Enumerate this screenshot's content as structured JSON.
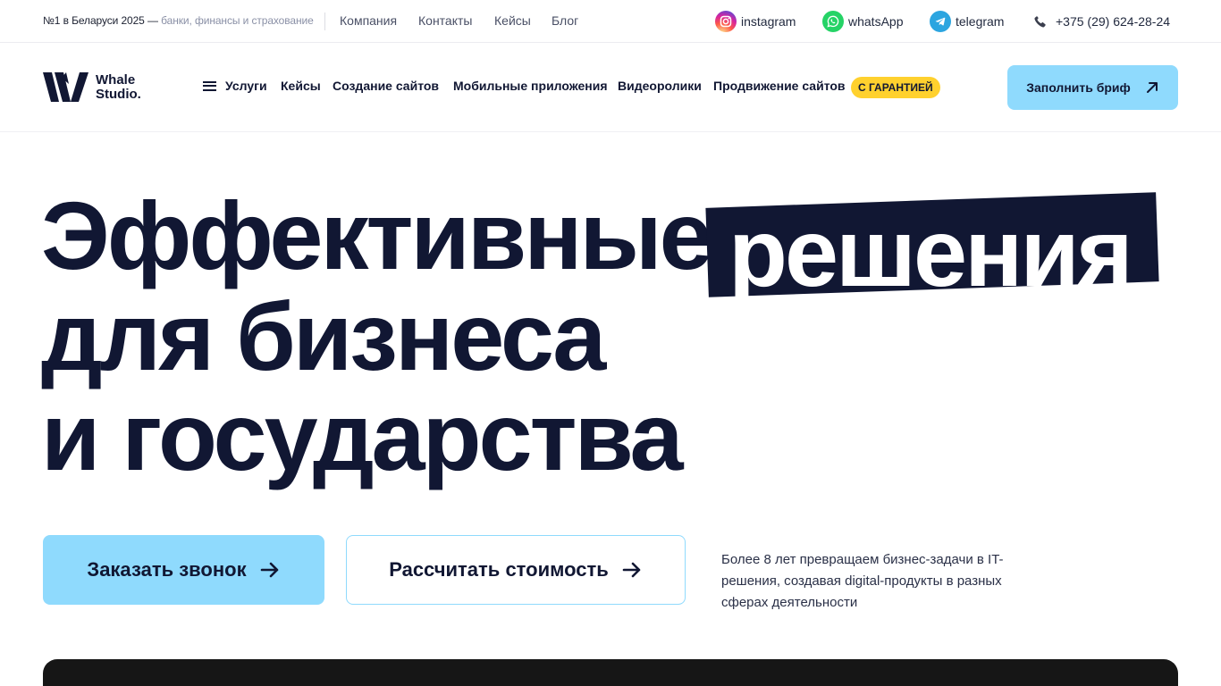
{
  "topbar": {
    "rank_strong": "№1 в Беларуси 2025 —",
    "rank_muted": "банки, финансы и страхование",
    "nav": [
      "Компания",
      "Контакты",
      "Кейсы",
      "Блог"
    ],
    "socials": [
      {
        "label": "instagram",
        "icon": "instagram-icon"
      },
      {
        "label": "whatsApp",
        "icon": "whatsapp-icon"
      },
      {
        "label": "telegram",
        "icon": "telegram-icon"
      }
    ],
    "phone": "+375 (29) 624-28-24"
  },
  "header": {
    "logo_text": "Whale\nStudio.",
    "nav": [
      "Услуги",
      "Кейсы",
      "Создание сайтов",
      "Мобильные приложения",
      "Видеоролики",
      "Продвижение сайтов"
    ],
    "badge": "С ГАРАНТИЕЙ",
    "brief_button": "Заполнить бриф"
  },
  "hero": {
    "line1": "Эффективные",
    "highlight": "решения",
    "line2": "для бизнеса",
    "line3": "и государства",
    "cta_primary": "Заказать звонок",
    "cta_secondary": "Рассчитать стоимость",
    "description": "Более 8 лет превращаем бизнес-задачи в IT-решения, создавая digital-продукты в разных сферах деятельности"
  },
  "colors": {
    "navy": "#111733",
    "accent_blue": "#8fdafd",
    "badge_yellow": "#ffd12e",
    "dark_panel": "#161616"
  }
}
